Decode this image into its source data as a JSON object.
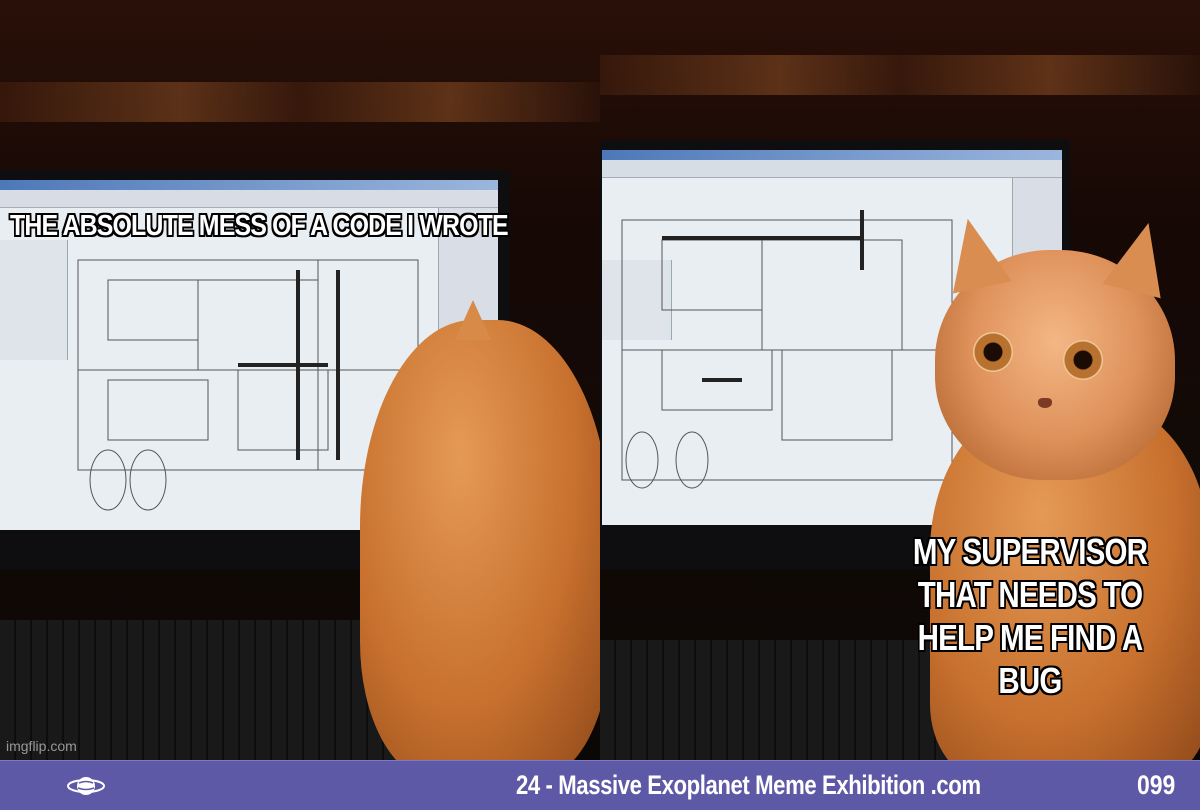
{
  "meme": {
    "top_caption": "THE ABSOLUTE MESS OF A CODE I WROTE",
    "bottom_caption": "MY SUPERVISOR THAT NEEDS TO HELP ME FIND A BUG",
    "watermark": "imgflip.com"
  },
  "footer": {
    "title": "24 - Massive Exoplanet Meme Exhibition .com",
    "number": "099",
    "logo_icon": "planet-logo-icon",
    "background_color": "#5d59a6",
    "text_color": "#ffffff"
  }
}
